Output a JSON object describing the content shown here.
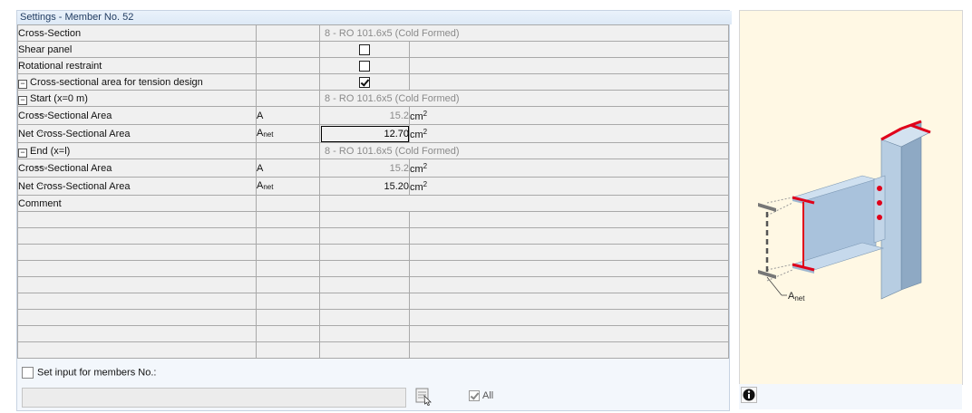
{
  "dialog": {
    "title": "Settings - Member No. 52"
  },
  "rows": {
    "cross_section": {
      "label": "Cross-Section",
      "value": "8 - RO 101.6x5 (Cold Formed)"
    },
    "shear_panel": {
      "label": "Shear panel",
      "checked": false
    },
    "rotational_restraint": {
      "label": "Rotational restraint",
      "checked": false
    },
    "tension_area": {
      "label": "Cross-sectional area for tension design",
      "checked": true
    },
    "start": {
      "label": "Start (x=0 m)",
      "value": "8 - RO 101.6x5 (Cold Formed)",
      "area": {
        "label": "Cross-Sectional Area",
        "symbol": "A",
        "value": "15.2",
        "unit": "cm"
      },
      "net": {
        "label": "Net Cross-Sectional Area",
        "symbol": "A",
        "symbol_sub": "net",
        "value": "12.70",
        "unit": "cm"
      }
    },
    "end": {
      "label": "End (x=l)",
      "value": "8 - RO 101.6x5 (Cold Formed)",
      "area": {
        "label": "Cross-Sectional Area",
        "symbol": "A",
        "value": "15.2",
        "unit": "cm"
      },
      "net": {
        "label": "Net Cross-Sectional Area",
        "symbol": "A",
        "symbol_sub": "net",
        "value": "15.20",
        "unit": "cm"
      }
    },
    "comment": {
      "label": "Comment",
      "value": ""
    },
    "unit_exponent": "2"
  },
  "bottom": {
    "set_input_label": "Set input for members No.:",
    "members_value": "",
    "all_label": "All",
    "all_checked": true
  },
  "illustration": {
    "label": "A",
    "label_sub": "net"
  },
  "icons": {
    "tree_collapse": "minus-box-icon",
    "select": "pick-members-icon",
    "info": "info-icon"
  },
  "colors": {
    "accent": "#1f3a5f",
    "highlight": "#e0001a",
    "steel": "#a9c2dc",
    "panel_bg": "#fff8e4"
  }
}
